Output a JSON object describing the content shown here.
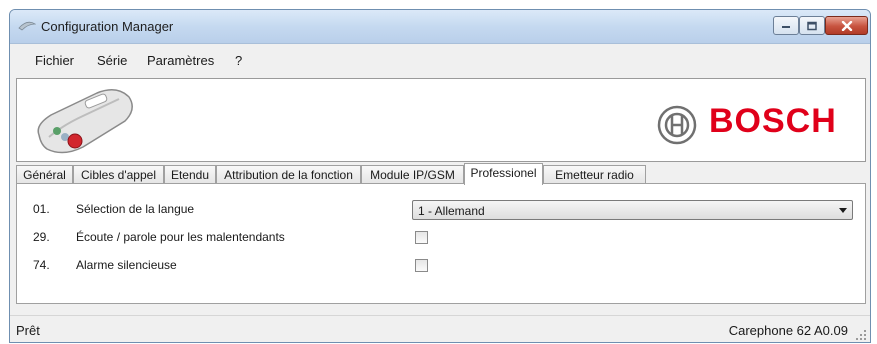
{
  "window": {
    "title": "Configuration Manager",
    "app_icon": "config-manager-app-icon",
    "controls": {
      "minimize_icon": "minimize-icon",
      "maximize_icon": "maximize-icon",
      "close_icon": "close-icon"
    }
  },
  "menu": [
    "Fichier",
    "Série",
    "Paramètres",
    "?"
  ],
  "banner": {
    "brand": "BOSCH",
    "brand_color": "#e0001a",
    "device_image": "carephone-device-image",
    "brand_logo": "bosch-armature-logo"
  },
  "tabs": [
    "Général",
    "Cibles d'appel",
    "Etendu",
    "Attribution de la fonction",
    "Module IP/GSM",
    "Professionel",
    "Emetteur radio"
  ],
  "active_tab": "Professionel",
  "settings": [
    {
      "num": "01.",
      "label": "Sélection de la langue",
      "control": "select",
      "value": "1 -  Allemand"
    },
    {
      "num": "29.",
      "label": "Écoute / parole pour les malentendants",
      "control": "checkbox",
      "checked": false
    },
    {
      "num": "74.",
      "label": "Alarme silencieuse",
      "control": "checkbox",
      "checked": false
    }
  ],
  "status": {
    "left": "Prêt",
    "right": "Carephone 62 A0.09"
  }
}
